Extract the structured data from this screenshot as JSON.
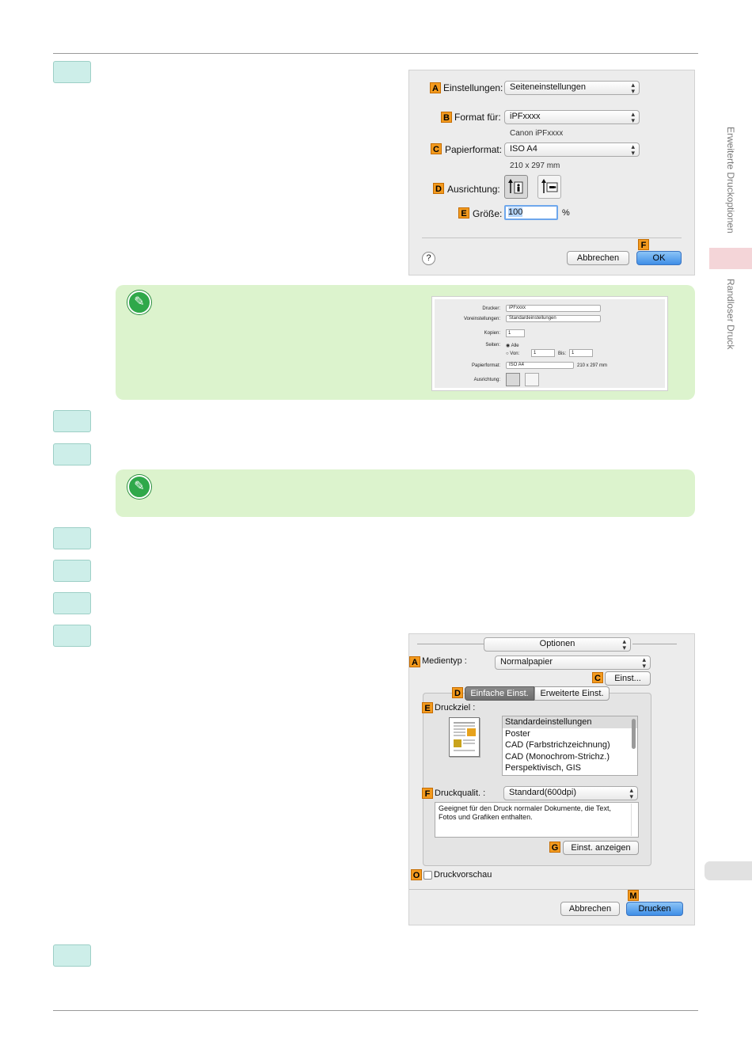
{
  "side_tabs": {
    "tab1": "Erweiterte Druckoptionen",
    "tab2": "Randloser Druck"
  },
  "dialog1": {
    "badges": {
      "a": "A",
      "b": "B",
      "c": "C",
      "d": "D",
      "e": "E",
      "f": "F"
    },
    "einstellungen_label": "Einstellungen:",
    "einstellungen_value": "Seiteneinstellungen",
    "format_label": "Format für:",
    "format_value": "iPFxxxx",
    "format_sub": "Canon iPFxxxx",
    "papier_label": "Papierformat:",
    "papier_value": "ISO A4",
    "papier_sub": "210 x 297 mm",
    "ausrichtung_label": "Ausrichtung:",
    "groesse_label": "Größe:",
    "groesse_value": "100",
    "percent": "%",
    "help": "?",
    "cancel": "Abbrechen",
    "ok": "OK"
  },
  "mini_dialog": {
    "drucker_label": "Drucker:",
    "drucker_value": "iPFxxxx",
    "vorein_label": "Voreinstellungen:",
    "vorein_value": "Standardeinstellungen",
    "kopien_label": "Kopien:",
    "kopien_value": "1",
    "seiten_label": "Seiten:",
    "alle": "Alle",
    "von": "Von:",
    "von_value": "1",
    "bis": "Bis:",
    "bis_value": "1",
    "papier_label": "Papierformat:",
    "papier_value": "ISO A4",
    "papier_sub": "210 x 297 mm",
    "ausrichtung_label": "Ausrichtung:"
  },
  "dialog2": {
    "badges": {
      "a": "A",
      "c": "C",
      "d": "D",
      "e": "E",
      "f": "F",
      "g": "G",
      "o": "O",
      "m": "M"
    },
    "optionen": "Optionen",
    "medientyp_label": "Medientyp :",
    "medientyp_value": "Normalpapier",
    "einst_button": "Einst...",
    "tab_einfache": "Einfache Einst.",
    "tab_erweiterte": "Erweiterte Einst.",
    "druckziel_label": "Druckziel :",
    "druckziel_items": [
      "Standardeinstellungen",
      "Poster",
      "CAD (Farbstrichzeichnung)",
      "CAD (Monochrom-Strichz.)",
      "Perspektivisch, GIS"
    ],
    "qualitaet_label": "Druckqualit. :",
    "qualitaet_value": "Standard(600dpi)",
    "description": "Geeignet für den Druck normaler Dokumente, die Text, Fotos und Grafiken enthalten.",
    "einst_anzeigen": "Einst. anzeigen",
    "vorschau_label": "Druckvorschau",
    "cancel": "Abbrechen",
    "print": "Drucken"
  },
  "colors": {
    "step_fill": "#cdeee9",
    "note_fill": "#dcf3cd",
    "badge": "#f39a1e",
    "button_blue": "#3f8ee7"
  }
}
